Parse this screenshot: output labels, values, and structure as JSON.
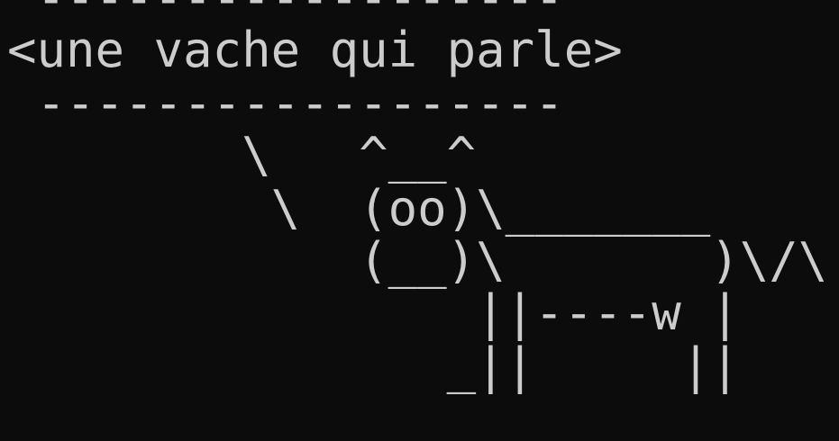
{
  "terminal": {
    "lines": [
      " ------------------",
      "<une vache qui parle>",
      " ------------------",
      "        \\   ^__^",
      "         \\  (oo)\\_______",
      "            (__)\\       )\\/\\",
      "                ||----w |",
      "               _||     ||"
    ]
  },
  "colors": {
    "background": "#0c0c0c",
    "foreground": "#cccccc"
  }
}
